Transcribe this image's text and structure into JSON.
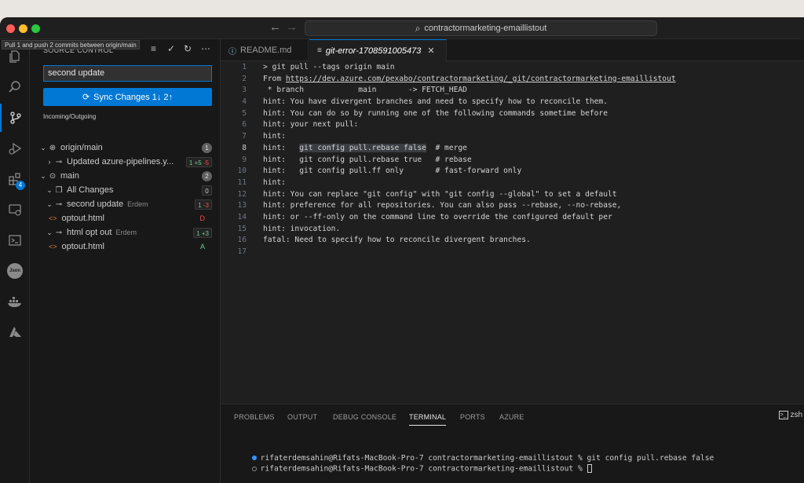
{
  "window": {
    "command_center": "contractormarketing-emaillistout",
    "tooltip": "Pull 1 and push 2 commits between origin/main"
  },
  "activity_bar": {
    "extensions_badge": "4"
  },
  "sidebar": {
    "title": "SOURCE CONTROL",
    "commit_message": "second update",
    "sync_button": "Sync Changes 1↓ 2↑",
    "section_label": "Incoming/Outgoing",
    "rows": [
      {
        "label": "origin/main",
        "count": "1"
      },
      {
        "label": "Updated azure-pipelines.y...",
        "stat_plus": "1 +5",
        "stat_minus": "-5"
      },
      {
        "label": "main",
        "count": "2"
      },
      {
        "label": "All Changes",
        "count": "0"
      },
      {
        "label": "second update",
        "author": "Erdem",
        "stat_plus": "1",
        "stat_minus": "-3"
      },
      {
        "label": "optout.html",
        "status": "D"
      },
      {
        "label": "html opt out",
        "author": "Erdem",
        "stat_plus": "1 +3"
      },
      {
        "label": "optout.html",
        "status": "A"
      }
    ]
  },
  "tabs": [
    {
      "label": "README.md"
    },
    {
      "label": "git-error-1708591005473"
    }
  ],
  "editor": {
    "lines": [
      {
        "n": "1",
        "text": "> git pull --tags origin main"
      },
      {
        "n": "2",
        "pre": "From ",
        "url": "https://dev.azure.com/pexabo/contractormarketing/_git/contractormarketing-emaillistout"
      },
      {
        "n": "3",
        "text": " * branch            main       -> FETCH_HEAD"
      },
      {
        "n": "4",
        "text": "hint: You have divergent branches and need to specify how to reconcile them."
      },
      {
        "n": "5",
        "text": "hint: You can do so by running one of the following commands sometime before"
      },
      {
        "n": "6",
        "text": "hint: your next pull:"
      },
      {
        "n": "7",
        "text": "hint:"
      },
      {
        "n": "8",
        "pre": "hint:   ",
        "hl": "git config pull.rebase false",
        "post": "  # merge"
      },
      {
        "n": "9",
        "text": "hint:   git config pull.rebase true   # rebase"
      },
      {
        "n": "10",
        "text": "hint:   git config pull.ff only       # fast-forward only"
      },
      {
        "n": "11",
        "text": "hint:"
      },
      {
        "n": "12",
        "text": "hint: You can replace \"git config\" with \"git config --global\" to set a default"
      },
      {
        "n": "13",
        "text": "hint: preference for all repositories. You can also pass --rebase, --no-rebase,"
      },
      {
        "n": "14",
        "text": "hint: or --ff-only on the command line to override the configured default per"
      },
      {
        "n": "15",
        "text": "hint: invocation."
      },
      {
        "n": "16",
        "text": "fatal: Need to specify how to reconcile divergent branches."
      },
      {
        "n": "17",
        "text": ""
      }
    ]
  },
  "panel": {
    "tabs": [
      "PROBLEMS",
      "OUTPUT",
      "DEBUG CONSOLE",
      "TERMINAL",
      "PORTS",
      "AZURE"
    ],
    "shell": "zsh",
    "terminal": [
      "rifaterdemsahin@Rifats-MacBook-Pro-7 contractormarketing-emaillistout % git config pull.rebase false",
      "rifaterdemsahin@Rifats-MacBook-Pro-7 contractormarketing-emaillistout % "
    ]
  },
  "colors": {
    "accent": "#0078d4",
    "added": "#73c991",
    "deleted": "#f14c4c"
  }
}
